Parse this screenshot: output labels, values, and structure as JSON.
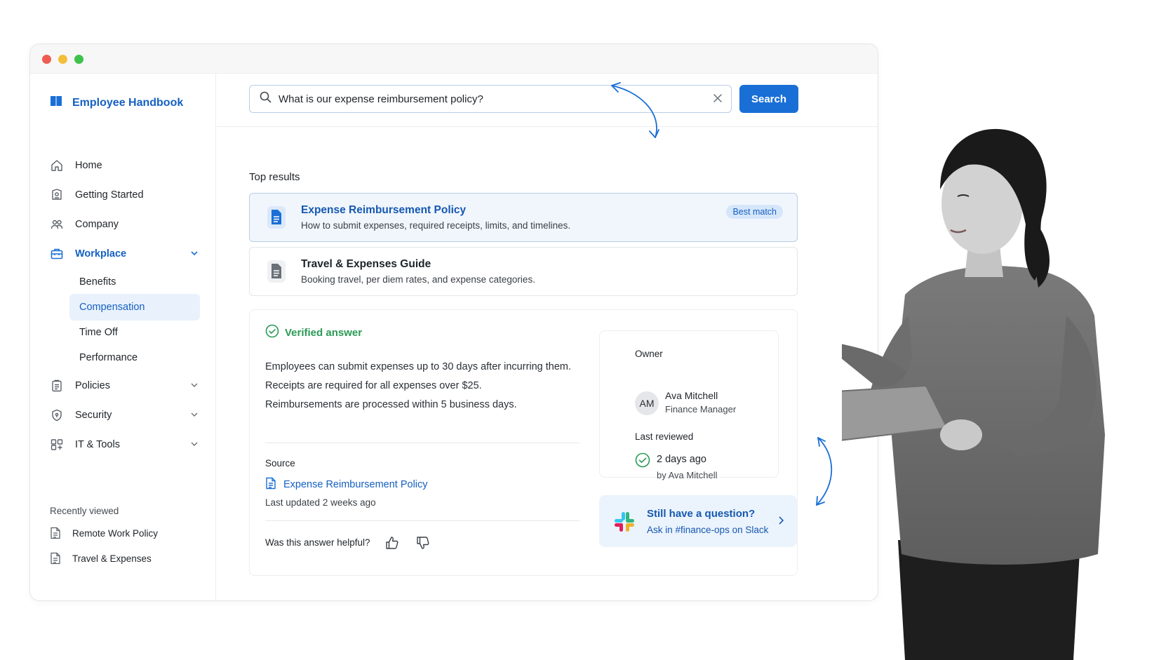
{
  "app": {
    "title": "Employee Handbook"
  },
  "sidebar": {
    "items": [
      {
        "label": "Home",
        "icon": "home-icon"
      },
      {
        "label": "Getting Started",
        "icon": "document-badge-icon"
      },
      {
        "label": "Company",
        "icon": "people-icon"
      },
      {
        "label": "Workplace",
        "icon": "briefcase-icon",
        "expanded": true
      },
      {
        "label": "Policies",
        "icon": "clipboard-icon"
      },
      {
        "label": "Security",
        "icon": "shield-icon"
      },
      {
        "label": "IT & Tools",
        "icon": "devices-icon"
      }
    ],
    "workplace_children": [
      "Benefits",
      "Compensation",
      "Time Off",
      "Performance"
    ],
    "selected_child": "Compensation",
    "recently_viewed_label": "Recently viewed",
    "recent": [
      "Remote Work Policy",
      "Travel & Expenses"
    ]
  },
  "search": {
    "query": "What is our expense reimbursement policy?",
    "button_label": "Search"
  },
  "results": {
    "label": "Top results",
    "items": [
      {
        "title": "Expense Reimbursement Policy",
        "description": "How to submit expenses, required receipts, limits, and timelines.",
        "badge": "Best match"
      },
      {
        "title": "Travel & Expenses Guide",
        "description": "Booking travel, per diem rates, and expense categories."
      }
    ]
  },
  "answer": {
    "status": "Verified answer",
    "lines": [
      "Employees can submit expenses up to 30 days after incurring them.",
      "Receipts are required for all expenses over $25.",
      "Reimbursements are processed within 5 business days."
    ],
    "source_label": "Source",
    "source_link": "Expense Reimbursement Policy",
    "updated": "Last updated 2 weeks ago",
    "helpful_prompt": "Was this answer helpful?"
  },
  "owner": {
    "label": "Owner",
    "initials": "AM",
    "name": "Ava Mitchell",
    "role": "Finance Manager",
    "reviewed_label": "Last reviewed",
    "reviewed_value": "2 days ago",
    "reviewed_by": "by Ava Mitchell"
  },
  "slack": {
    "title": "Still have a question?",
    "subtitle": "Ask in #finance-ops on Slack"
  },
  "colors": {
    "accent": "#1a6fd6",
    "link": "#1560c2",
    "verified": "#2a9a55",
    "best_match_bg": "#f1f6fd"
  }
}
